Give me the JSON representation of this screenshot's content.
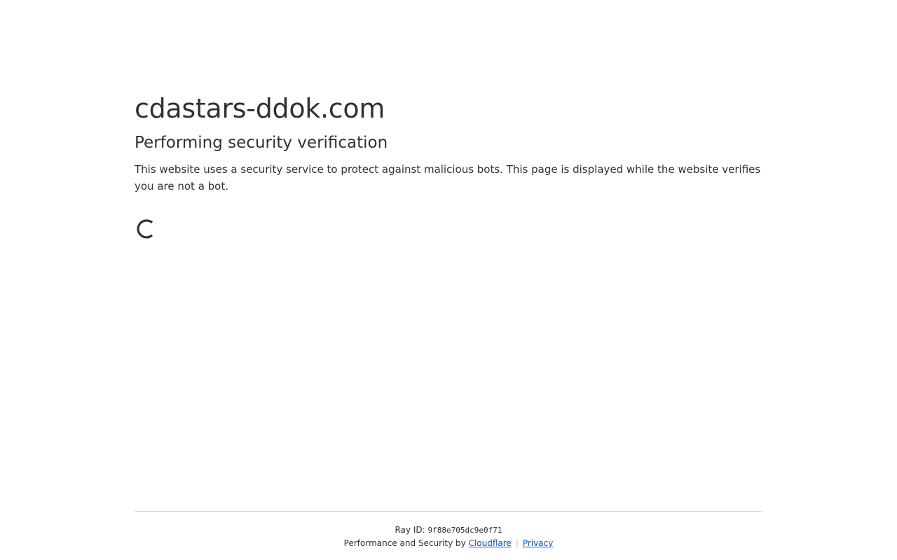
{
  "main": {
    "domain": "cdastars-ddok.com",
    "heading": "Performing security verification",
    "description": "This website uses a security service to protect against malicious bots. This page is displayed while the website verifies you are not a bot.",
    "spinner_icon": "loading-spinner-icon"
  },
  "footer": {
    "ray_label": "Ray ID:",
    "ray_id": "9f88e705dc9e0f71",
    "performance_text": "Performance and Security by",
    "cloudflare_link": "Cloudflare",
    "separator": "|",
    "privacy_link": "Privacy"
  },
  "colors": {
    "text": "#313131",
    "link": "#0051c3",
    "divider": "#d9d9d9"
  }
}
